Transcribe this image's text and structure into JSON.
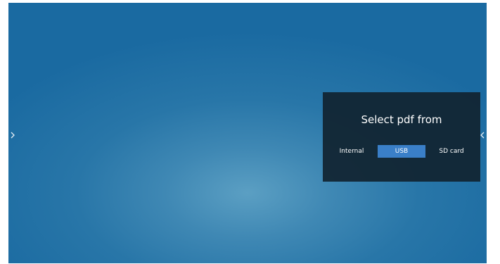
{
  "nav": {
    "left_arrow": "›",
    "right_arrow": "‹",
    "left_icon": "chevron-right-icon",
    "right_icon": "chevron-left-icon"
  },
  "dialog": {
    "title": "Select pdf from",
    "options": [
      {
        "label": "Internal",
        "selected": false
      },
      {
        "label": "USB",
        "selected": true
      },
      {
        "label": "SD card",
        "selected": false
      }
    ]
  },
  "colors": {
    "background": "#2876a8",
    "dialog_background": "#112330",
    "selected_option": "#3a7fc8",
    "text": "#ffffff"
  }
}
